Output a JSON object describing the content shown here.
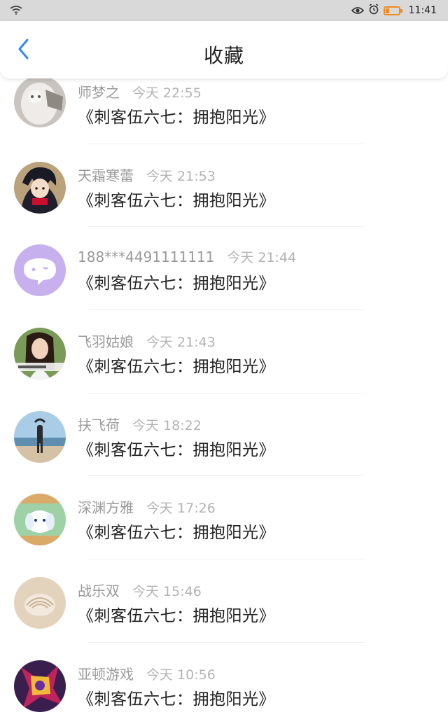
{
  "status_bar": {
    "time": "11:41",
    "icons": [
      "wifi-icon",
      "eye-icon",
      "alarm-icon",
      "battery-icon"
    ]
  },
  "header": {
    "title": "收藏",
    "back_icon": "chevron-left-icon"
  },
  "colors": {
    "accent": "#2d8cf0",
    "battery": "#f08a24",
    "status_bar_bg": "#d9d9d9"
  },
  "items": [
    {
      "author": "师梦之",
      "time": "今天 22:55",
      "title": "《刺客伍六七：拥抱阳光》",
      "avatar": "cat-photo"
    },
    {
      "author": "天霜寒蕾",
      "time": "今天 21:53",
      "title": "《刺客伍六七：拥抱阳光》",
      "avatar": "anime-boy"
    },
    {
      "author": "188***4491111111",
      "time": "今天 21:44",
      "title": "《刺客伍六七：拥抱阳光》",
      "avatar": "chat-bubble-icon"
    },
    {
      "author": "飞羽姑娘",
      "time": "今天 21:43",
      "title": "《刺客伍六七：拥抱阳光》",
      "avatar": "girl-photo"
    },
    {
      "author": "扶飞荷",
      "time": "今天 18:22",
      "title": "《刺客伍六七：拥抱阳光》",
      "avatar": "beach-silhouette"
    },
    {
      "author": "深渊方雅",
      "time": "今天 17:26",
      "title": "《刺客伍六七：拥抱阳光》",
      "avatar": "cartoon-dog"
    },
    {
      "author": "战乐双",
      "time": "今天 15:46",
      "title": "《刺客伍六七：拥抱阳光》",
      "avatar": "seashell"
    },
    {
      "author": "亚顿游戏",
      "time": "今天 10:56",
      "title": "《刺客伍六七：拥抱阳光》",
      "avatar": "game-character"
    }
  ]
}
